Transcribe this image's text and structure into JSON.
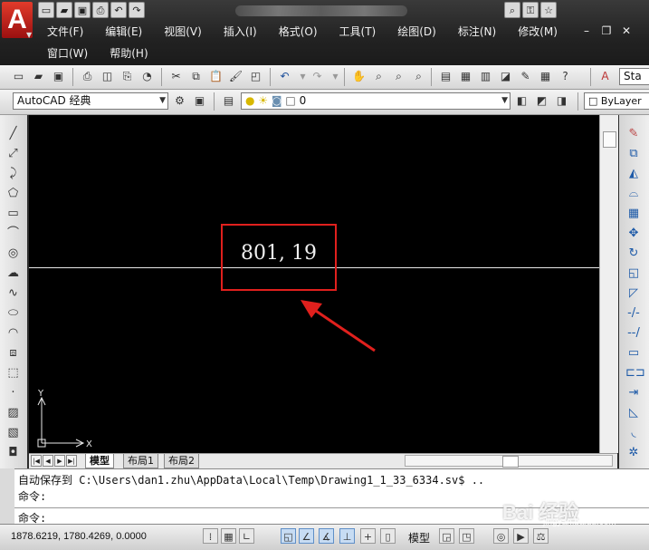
{
  "quick_access": [
    "new",
    "open",
    "save",
    "print",
    "undo",
    "redo"
  ],
  "menus_row1": [
    "文件(F)",
    "编辑(E)",
    "视图(V)",
    "插入(I)",
    "格式(O)",
    "工具(T)",
    "绘图(D)",
    "标注(N)",
    "修改(M)"
  ],
  "menus_row2": [
    "窗口(W)",
    "帮助(H)"
  ],
  "workspace_combo": "AutoCAD 经典",
  "layer_combo": "0",
  "color_combo": "ByLayer",
  "toolbar_partial_label": "Sta",
  "coordinate_tooltip": "801, 19",
  "ucs": {
    "x_label": "X",
    "y_label": "Y"
  },
  "tabs": [
    "模型",
    "布局1",
    "布局2"
  ],
  "active_tab": "模型",
  "command": {
    "line1": "自动保存到 C:\\Users\\dan1.zhu\\AppData\\Local\\Temp\\Drawing1_1_33_6334.sv$ ..",
    "line2": "命令:",
    "prompt": "命令:"
  },
  "status": {
    "coords": "1878.6219, 1780.4269, 0.0000",
    "space_label": "模型"
  },
  "watermark": {
    "text": "Bai 经验",
    "sub": "jingyan.baidu.com"
  },
  "colors": {
    "highlight_box": "#e0201d",
    "canvas": "#000000",
    "logo": "#c4221a"
  }
}
